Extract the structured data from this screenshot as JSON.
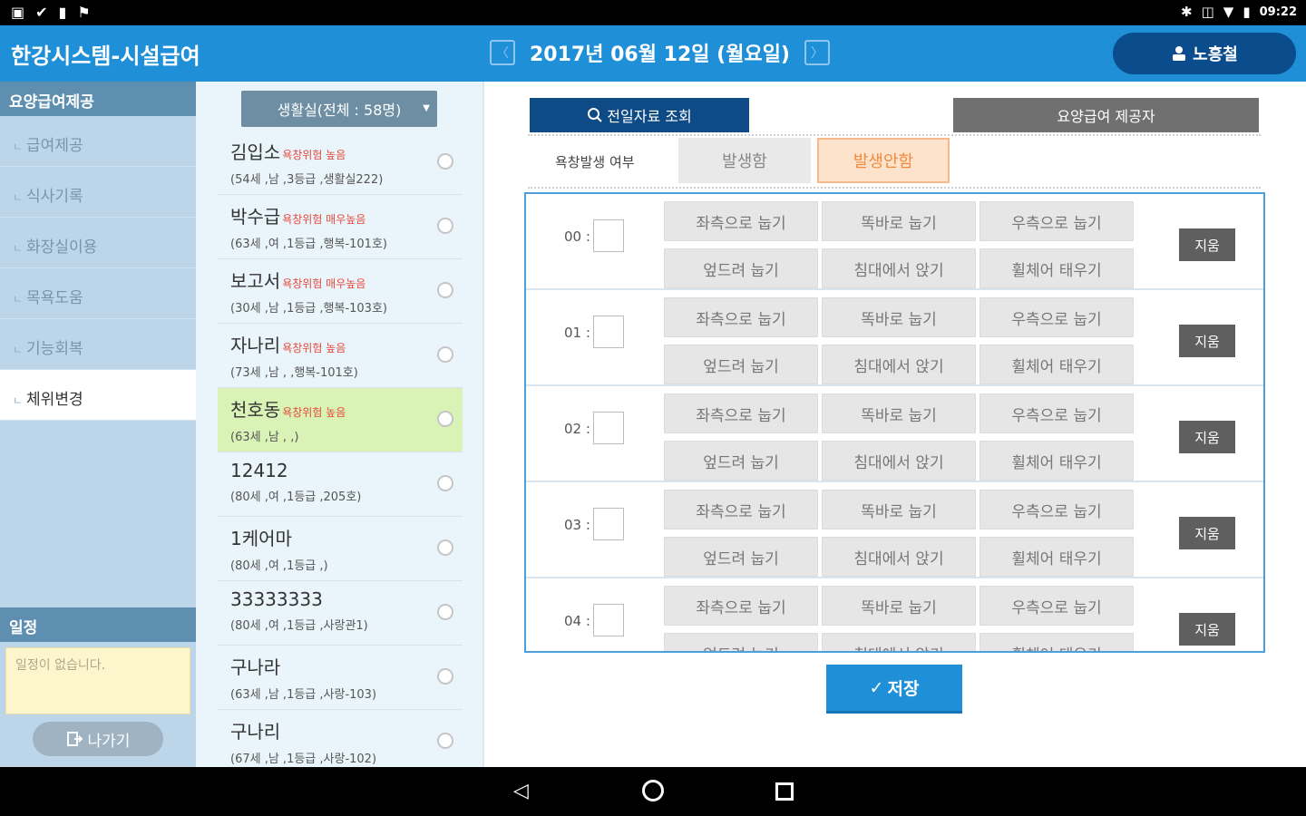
{
  "status": {
    "time": "09:22"
  },
  "header": {
    "app_title": "한강시스템-시설급여",
    "date": "2017년 06월 12일 (월요일)",
    "prev_arrow": "〈",
    "next_arrow": "〉",
    "user_name": "노흥철"
  },
  "sidebar": {
    "section_title": "요양급여제공",
    "items": [
      "급여제공",
      "식사기록",
      "화장실이용",
      "목욕도움",
      "기능회복",
      "체위변경"
    ],
    "active_index": 5,
    "schedule_title": "일정",
    "schedule_empty": "일정이 없습니다.",
    "exit_label": "나가기"
  },
  "residents": {
    "room_select": "생활실(전체 : 58명)",
    "items": [
      {
        "name": "김입소",
        "tag": "욕창위험 높음",
        "info": "(54세 ,남 ,3등급 ,생활실222)"
      },
      {
        "name": "박수급",
        "tag": "욕창위험 매우높음",
        "info": "(63세 ,여 ,1등급 ,행복-101호)"
      },
      {
        "name": "보고서",
        "tag": "욕창위험 매우높음",
        "info": "(30세 ,남 ,1등급 ,행복-103호)"
      },
      {
        "name": "자나리",
        "tag": "욕창위험 높음",
        "info": "(73세 ,남 , ,행복-101호)"
      },
      {
        "name": "천호동",
        "tag": "욕창위험 높음",
        "info": "(63세 ,남 , ,)"
      },
      {
        "name": "12412",
        "tag": "",
        "info": "(80세 ,여 ,1등급 ,205호)"
      },
      {
        "name": "1케어마",
        "tag": "",
        "info": "(80세 ,여 ,1등급 ,)"
      },
      {
        "name": "33333333",
        "tag": "",
        "info": "(80세 ,여 ,1등급 ,사랑관1)"
      },
      {
        "name": "구나라",
        "tag": "",
        "info": "(63세 ,남 ,1등급 ,사랑-103)"
      },
      {
        "name": "구나리",
        "tag": "",
        "info": "(67세 ,남 ,1등급 ,사랑-102)"
      }
    ],
    "selected_index": 4
  },
  "main": {
    "prev_day_btn": "전일자료 조회",
    "provider_btn": "요양급여 제공자",
    "occurrence_label": "욕창발생 여부",
    "occurrence_yes": "발생함",
    "occurrence_no": "발생안함",
    "positions": [
      "좌측으로 눕기",
      "똑바로 눕기",
      "우측으로 눕기",
      "엎드려 눕기",
      "침대에서 앉기",
      "휠체어 태우기"
    ],
    "delete_label": "지움",
    "hours": [
      "00 :",
      "01 :",
      "02 :",
      "03 :",
      "04 :"
    ],
    "save_label": "저장"
  }
}
